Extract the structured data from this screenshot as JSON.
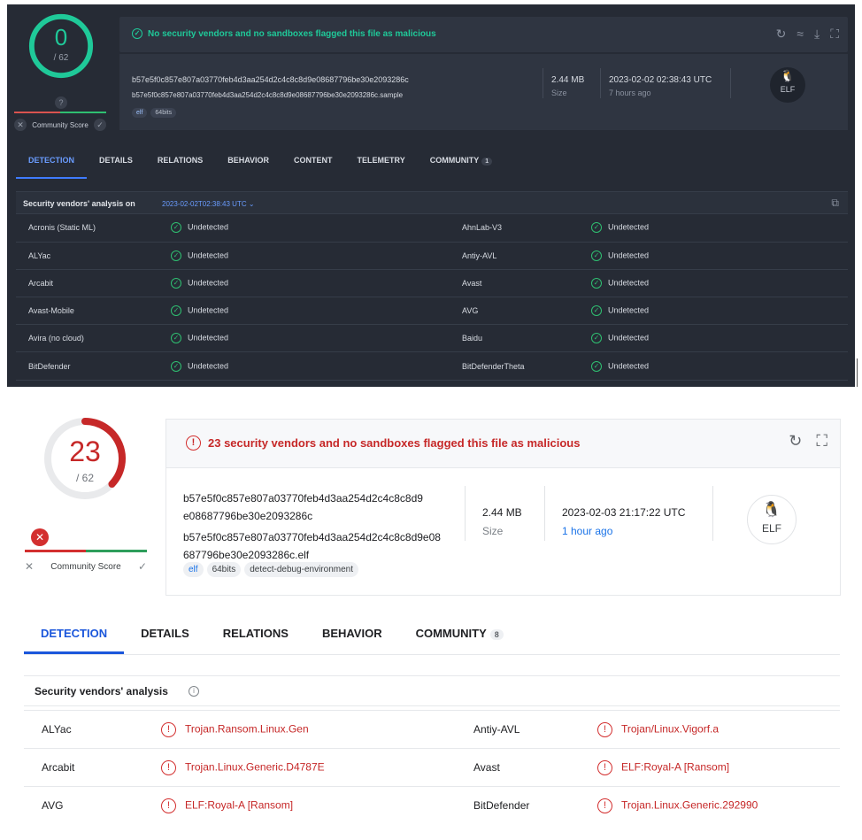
{
  "top": {
    "score": {
      "detections": "0",
      "total": "/ 62",
      "unknown_badge": "?"
    },
    "community_score_label": "Community Score",
    "banner": "No security vendors and no sandboxes flagged this file as malicious",
    "file": {
      "hash": "b57e5f0c857e807a03770feb4d3aa254d2c4c8c8d9e08687796be30e2093286c",
      "name": "b57e5f0c857e807a03770feb4d3aa254d2c4c8c8d9e08687796be30e2093286c.sample",
      "tags": [
        "elf",
        "64bits"
      ],
      "size": "2.44 MB",
      "size_label": "Size",
      "date": "2023-02-02 02:38:43 UTC",
      "date_relative": "7 hours ago",
      "type_label": "ELF"
    },
    "tabs": [
      "DETECTION",
      "DETAILS",
      "RELATIONS",
      "BEHAVIOR",
      "CONTENT",
      "TELEMETRY",
      "COMMUNITY"
    ],
    "community_count": "1",
    "analysis_title": "Security vendors' analysis on",
    "analysis_date": "2023-02-02T02:38:43 UTC",
    "rows": [
      {
        "v1": "Acronis (Static ML)",
        "r1": "Undetected",
        "v2": "AhnLab-V3",
        "r2": "Undetected"
      },
      {
        "v1": "ALYac",
        "r1": "Undetected",
        "v2": "Antiy-AVL",
        "r2": "Undetected"
      },
      {
        "v1": "Arcabit",
        "r1": "Undetected",
        "v2": "Avast",
        "r2": "Undetected"
      },
      {
        "v1": "Avast-Mobile",
        "r1": "Undetected",
        "v2": "AVG",
        "r2": "Undetected"
      },
      {
        "v1": "Avira (no cloud)",
        "r1": "Undetected",
        "v2": "Baidu",
        "r2": "Undetected"
      },
      {
        "v1": "BitDefender",
        "r1": "Undetected",
        "v2": "BitDefenderTheta",
        "r2": "Undetected"
      }
    ]
  },
  "bottom": {
    "score": {
      "detections": "23",
      "total": "/ 62"
    },
    "community_score_label": "Community Score",
    "banner": "23 security vendors and no sandboxes flagged this file as malicious",
    "file": {
      "hash_line1": "b57e5f0c857e807a03770feb4d3aa254d2c4c8c8d9",
      "hash_line2": "e08687796be30e2093286c",
      "name_line1": "b57e5f0c857e807a03770feb4d3aa254d2c4c8c8d9e08",
      "name_line2": "687796be30e2093286c.elf",
      "tags": [
        "elf",
        "64bits",
        "detect-debug-environment"
      ],
      "size": "2.44 MB",
      "size_label": "Size",
      "date": "2023-02-03 21:17:22 UTC",
      "date_relative": "1 hour ago",
      "type_label": "ELF"
    },
    "tabs": [
      "DETECTION",
      "DETAILS",
      "RELATIONS",
      "BEHAVIOR",
      "COMMUNITY"
    ],
    "community_count": "8",
    "analysis_title": "Security vendors' analysis",
    "rows": [
      {
        "v1": "ALYac",
        "r1": "Trojan.Ransom.Linux.Gen",
        "v2": "Antiy-AVL",
        "r2": "Trojan/Linux.Vigorf.a"
      },
      {
        "v1": "Arcabit",
        "r1": "Trojan.Linux.Generic.D4787E",
        "v2": "Avast",
        "r2": "ELF:Royal-A [Ransom]"
      },
      {
        "v1": "AVG",
        "r1": "ELF:Royal-A [Ransom]",
        "v2": "BitDefender",
        "r2": "Trojan.Linux.Generic.292990"
      }
    ]
  },
  "colors": {
    "clean": "#1fc999",
    "malicious": "#c62828",
    "accent": "#1a56db"
  }
}
